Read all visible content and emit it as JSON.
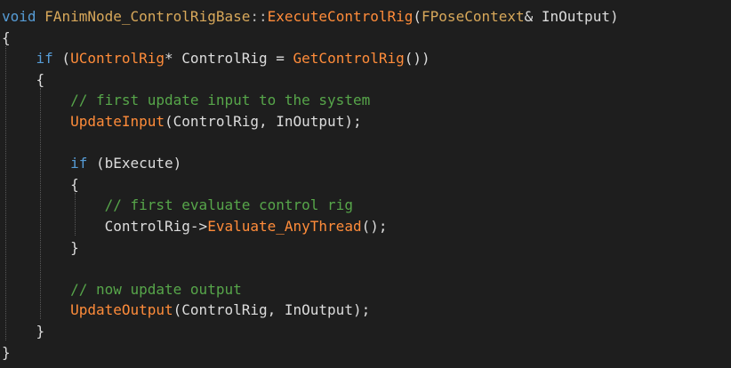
{
  "editor": {
    "background": "#1e1e1e",
    "colors": {
      "keyword": "#569cd6",
      "function": "#ff8c3a",
      "type": "#d8a85a",
      "comment": "#57a64a",
      "text": "#dcdcdc"
    },
    "lines": [
      {
        "tokens": [
          {
            "t": "void",
            "c": "kw"
          },
          {
            "t": " ",
            "c": "pl"
          },
          {
            "t": "FAnimNode_ControlRigBase",
            "c": "ty"
          },
          {
            "t": "::",
            "c": "pc"
          },
          {
            "t": "ExecuteControlRig",
            "c": "fn"
          },
          {
            "t": "(",
            "c": "pl"
          },
          {
            "t": "FPoseContext",
            "c": "ty"
          },
          {
            "t": "& InOutput)",
            "c": "pl"
          }
        ]
      },
      {
        "tokens": [
          {
            "t": "{",
            "c": "pl"
          }
        ]
      },
      {
        "tokens": [
          {
            "t": "    ",
            "c": "pl"
          },
          {
            "t": "if",
            "c": "kw"
          },
          {
            "t": " (",
            "c": "pl"
          },
          {
            "t": "UControlRig",
            "c": "fn"
          },
          {
            "t": "* ControlRig = ",
            "c": "pl"
          },
          {
            "t": "GetControlRig",
            "c": "fn"
          },
          {
            "t": "())",
            "c": "pl"
          }
        ]
      },
      {
        "tokens": [
          {
            "t": "    {",
            "c": "pl"
          }
        ]
      },
      {
        "tokens": [
          {
            "t": "        // first update input to the system",
            "c": "cm"
          }
        ]
      },
      {
        "tokens": [
          {
            "t": "        ",
            "c": "pl"
          },
          {
            "t": "UpdateInput",
            "c": "fn"
          },
          {
            "t": "(ControlRig, InOutput);",
            "c": "pl"
          }
        ]
      },
      {
        "tokens": []
      },
      {
        "tokens": [
          {
            "t": "        ",
            "c": "pl"
          },
          {
            "t": "if",
            "c": "kw"
          },
          {
            "t": " (bExecute)",
            "c": "pl"
          }
        ]
      },
      {
        "tokens": [
          {
            "t": "        {",
            "c": "pl"
          }
        ]
      },
      {
        "tokens": [
          {
            "t": "            // first evaluate control rig",
            "c": "cm"
          }
        ]
      },
      {
        "tokens": [
          {
            "t": "            ControlRig->",
            "c": "pl"
          },
          {
            "t": "Evaluate_AnyThread",
            "c": "fn"
          },
          {
            "t": "();",
            "c": "pl"
          }
        ]
      },
      {
        "tokens": [
          {
            "t": "        }",
            "c": "pl"
          }
        ]
      },
      {
        "tokens": []
      },
      {
        "tokens": [
          {
            "t": "        // now update output",
            "c": "cm"
          }
        ]
      },
      {
        "tokens": [
          {
            "t": "        ",
            "c": "pl"
          },
          {
            "t": "UpdateOutput",
            "c": "fn"
          },
          {
            "t": "(ControlRig, InOutput);",
            "c": "pl"
          }
        ]
      },
      {
        "tokens": [
          {
            "t": "    }",
            "c": "pl"
          }
        ]
      },
      {
        "tokens": [
          {
            "t": "}",
            "c": "pl"
          }
        ]
      }
    ]
  }
}
